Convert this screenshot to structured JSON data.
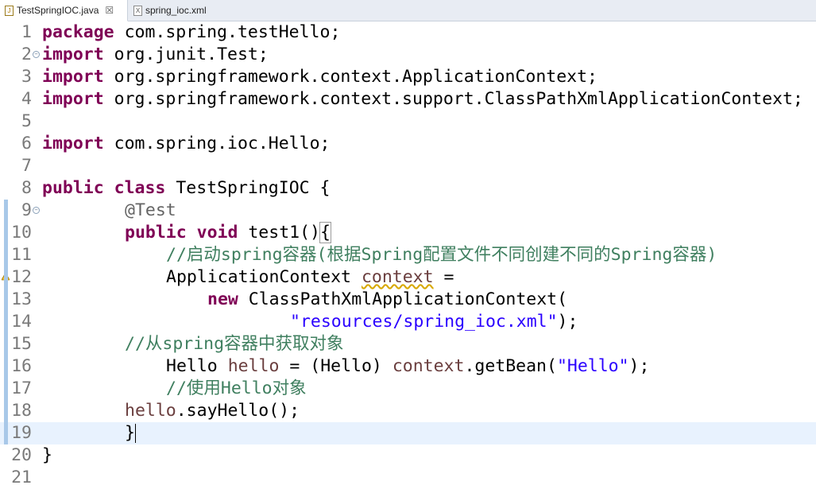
{
  "tabs": [
    {
      "label": "TestSpringIOC.java",
      "close": "☒"
    },
    {
      "label": "spring_ioc.xml"
    }
  ],
  "lines": [
    {
      "n": "1",
      "parts": [
        [
          "kw",
          "package"
        ],
        [
          "",
          "com.spring.testHello;"
        ]
      ]
    },
    {
      "n": "2",
      "parts": [
        [
          "kw",
          "import"
        ],
        [
          "",
          "org.junit.Test;"
        ]
      ]
    },
    {
      "n": "3",
      "parts": [
        [
          "kw",
          "import"
        ],
        [
          "",
          "org.springframework.context.ApplicationContext;"
        ]
      ]
    },
    {
      "n": "4",
      "parts": [
        [
          "kw",
          "import"
        ],
        [
          "",
          "org.springframework.context.support.ClassPathXmlApplicationContext;"
        ]
      ]
    },
    {
      "n": "5",
      "parts": []
    },
    {
      "n": "6",
      "parts": [
        [
          "kw",
          "import"
        ],
        [
          "",
          "com.spring.ioc.Hello;"
        ]
      ]
    },
    {
      "n": "7",
      "parts": []
    },
    {
      "n": "8",
      "parts": [
        [
          "kw",
          "public"
        ],
        [
          "kw",
          "class"
        ],
        [
          "",
          "TestSpringIOC {"
        ]
      ]
    },
    {
      "n": "9",
      "parts": [
        [
          "ann",
          "@Test"
        ]
      ]
    },
    {
      "n": "10",
      "parts": [
        [
          "kw",
          "public"
        ],
        [
          "kw",
          "void"
        ],
        [
          "",
          "test1()"
        ],
        [
          "bracket",
          "{"
        ]
      ]
    },
    {
      "n": "11",
      "parts": [
        [
          "cm",
          "//启动spring容器(根据Spring配置文件不同创建不同的Spring容器)"
        ]
      ]
    },
    {
      "n": "12",
      "parts": [
        [
          "",
          "ApplicationContext"
        ],
        [
          "fldwarn",
          "context"
        ],
        [
          "",
          "="
        ]
      ]
    },
    {
      "n": "13",
      "parts": [
        [
          "kw",
          "new"
        ],
        [
          "",
          "ClassPathXmlApplicationContext("
        ]
      ]
    },
    {
      "n": "14",
      "parts": [
        [
          "str",
          "\"resources/spring_ioc.xml\""
        ],
        [
          "",
          ");"
        ]
      ]
    },
    {
      "n": "15",
      "parts": [
        [
          "cm",
          "//从spring容器中获取对象"
        ]
      ]
    },
    {
      "n": "16",
      "parts": [
        [
          "",
          "Hello"
        ],
        [
          "fld",
          "hello"
        ],
        [
          "",
          "= (Hello)"
        ],
        [
          "fld",
          "context"
        ],
        [
          "",
          ".getBean("
        ],
        [
          "str",
          "\"Hello\""
        ],
        [
          "",
          ");"
        ]
      ]
    },
    {
      "n": "17",
      "parts": [
        [
          "cm",
          "//使用Hello对象"
        ]
      ]
    },
    {
      "n": "18",
      "parts": [
        [
          "fld",
          "hello"
        ],
        [
          "",
          ".sayHello();"
        ]
      ]
    },
    {
      "n": "19",
      "parts": [
        [
          "",
          "}"
        ]
      ]
    },
    {
      "n": "20",
      "parts": [
        [
          "",
          "}"
        ]
      ]
    },
    {
      "n": "21",
      "parts": []
    }
  ]
}
